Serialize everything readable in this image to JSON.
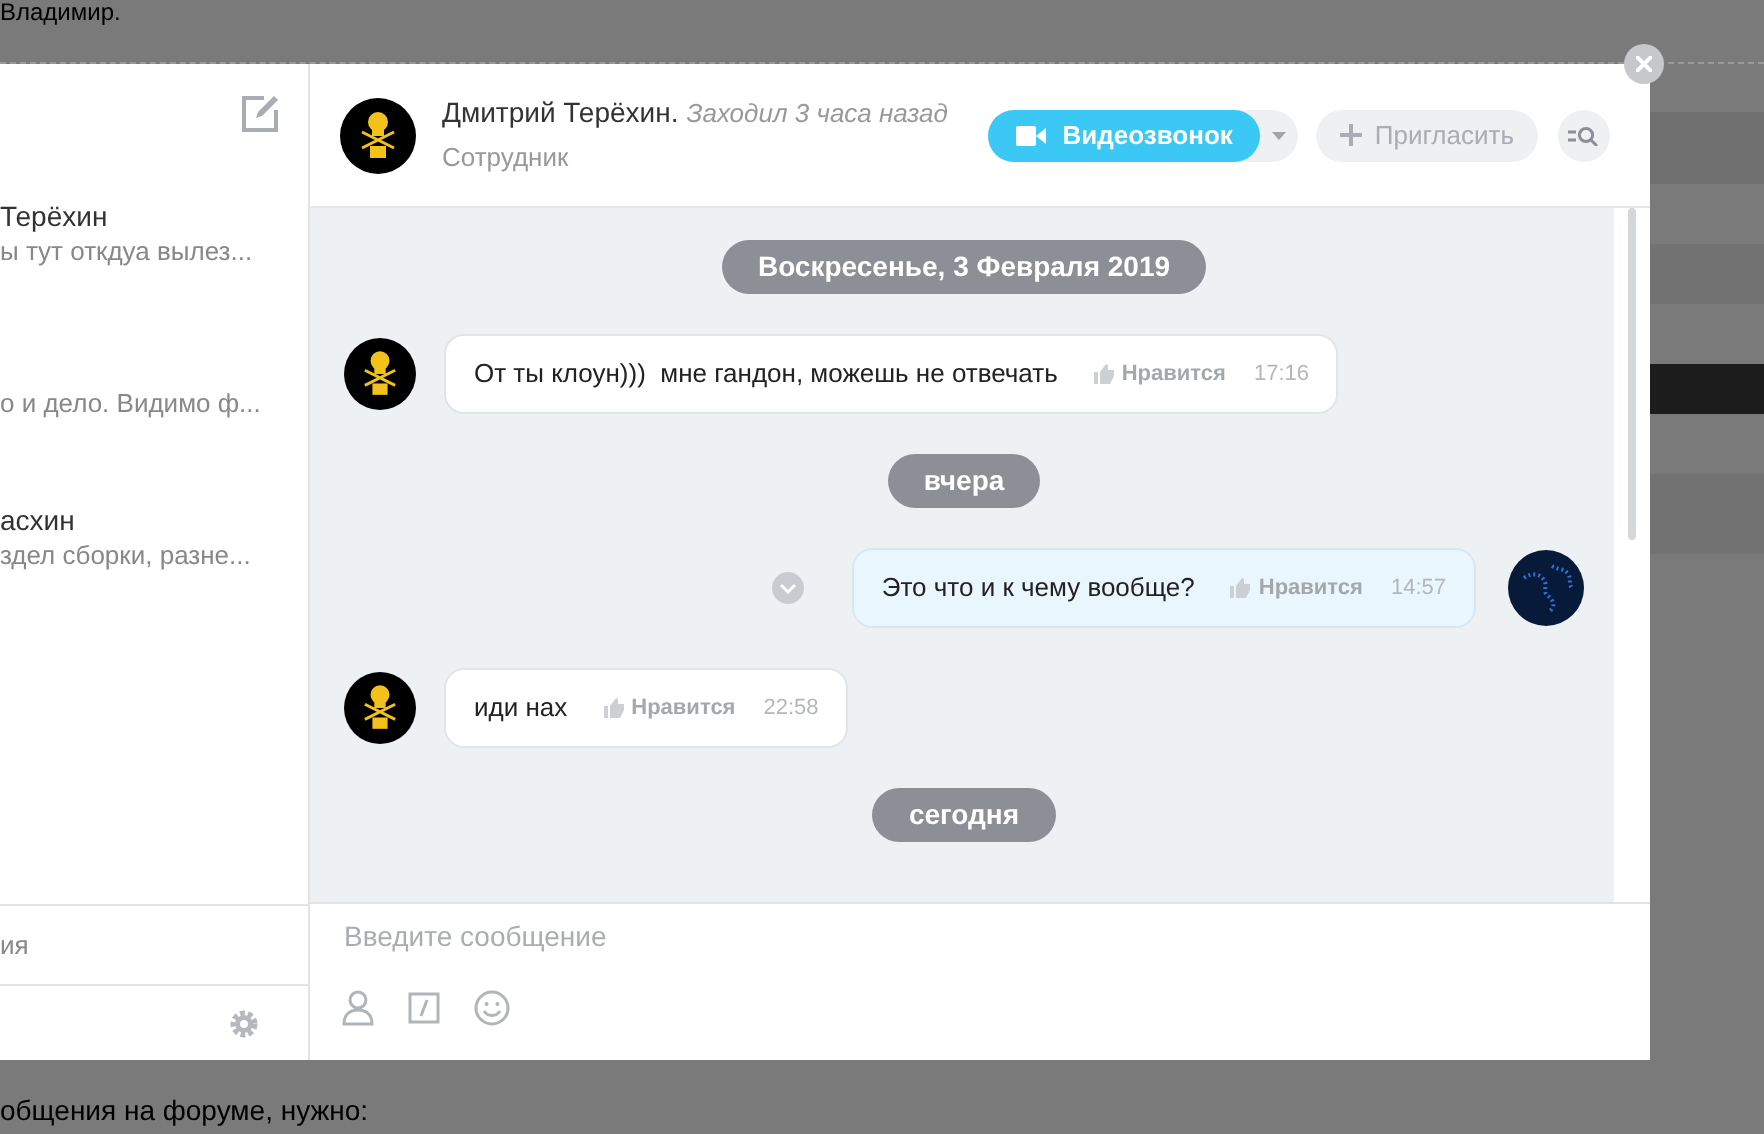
{
  "background_page": {
    "top_text": "Владимир.",
    "bottom_text": "общения на форуме, нужно:"
  },
  "sidebar": {
    "items": [
      {
        "name": "Терёхин",
        "preview": "ы тут откдуа вылез..."
      },
      {
        "preview": "о и дело. Видимо ф..."
      },
      {
        "name": "асхин",
        "preview": "здел сборки, разне..."
      }
    ],
    "search_text": "ия"
  },
  "chat": {
    "contact": {
      "name": "Дмитрий Терёхин.",
      "last_seen": "Заходил 3 часа назад",
      "role": "Сотрудник"
    },
    "video_button": "Видеозвонок",
    "invite_button": "Пригласить",
    "messages": [
      {
        "kind": "date",
        "text": "Воскресенье, 3 Февраля 2019"
      },
      {
        "kind": "incoming",
        "text": "От ты клоун)))  мне гандон, можешь не отвечать",
        "like": "Нравится",
        "time": "17:16"
      },
      {
        "kind": "date",
        "text": "вчера"
      },
      {
        "kind": "outgoing",
        "text": "Это что и к чему вообще?",
        "like": "Нравится",
        "time": "14:57"
      },
      {
        "kind": "incoming",
        "text": "иди нах",
        "like": "Нравится",
        "time": "22:58"
      },
      {
        "kind": "date",
        "text": "сегодня"
      }
    ],
    "input": {
      "placeholder": "Введите сообщение"
    }
  }
}
